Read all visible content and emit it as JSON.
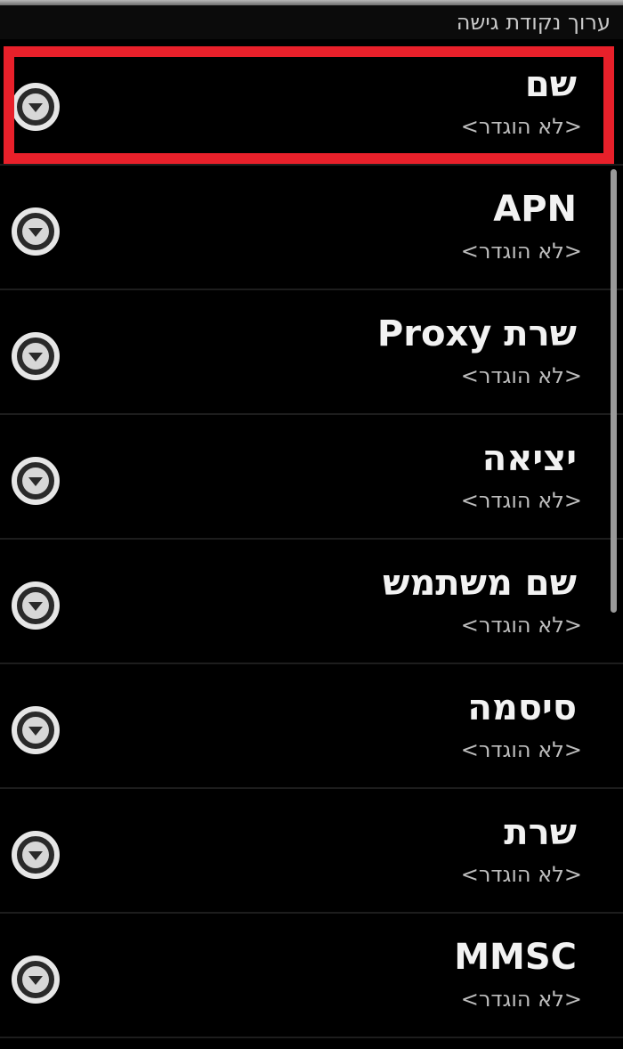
{
  "header": {
    "title": "ערוך נקודת גישה"
  },
  "settings": {
    "not_set_value": "<לא הוגדר>",
    "items": [
      {
        "label": "שם",
        "value": "<לא הוגדר>"
      },
      {
        "label": "APN",
        "value": "<לא הוגדר>"
      },
      {
        "label": "שרת Proxy",
        "value": "<לא הוגדר>"
      },
      {
        "label": "יציאה",
        "value": "<לא הוגדר>"
      },
      {
        "label": "שם משתמש",
        "value": "<לא הוגדר>"
      },
      {
        "label": "סיסמה",
        "value": "<לא הוגדר>"
      },
      {
        "label": "שרת",
        "value": "<לא הוגדר>"
      },
      {
        "label": "MMSC",
        "value": "<לא הוגדר>"
      }
    ]
  },
  "icons": {
    "row_icon": "chevron-down-circle-icon"
  },
  "colors": {
    "highlight": "#e8202a",
    "background": "#000000",
    "text_primary": "#f2f2f2",
    "text_secondary": "#bdbdbd"
  }
}
